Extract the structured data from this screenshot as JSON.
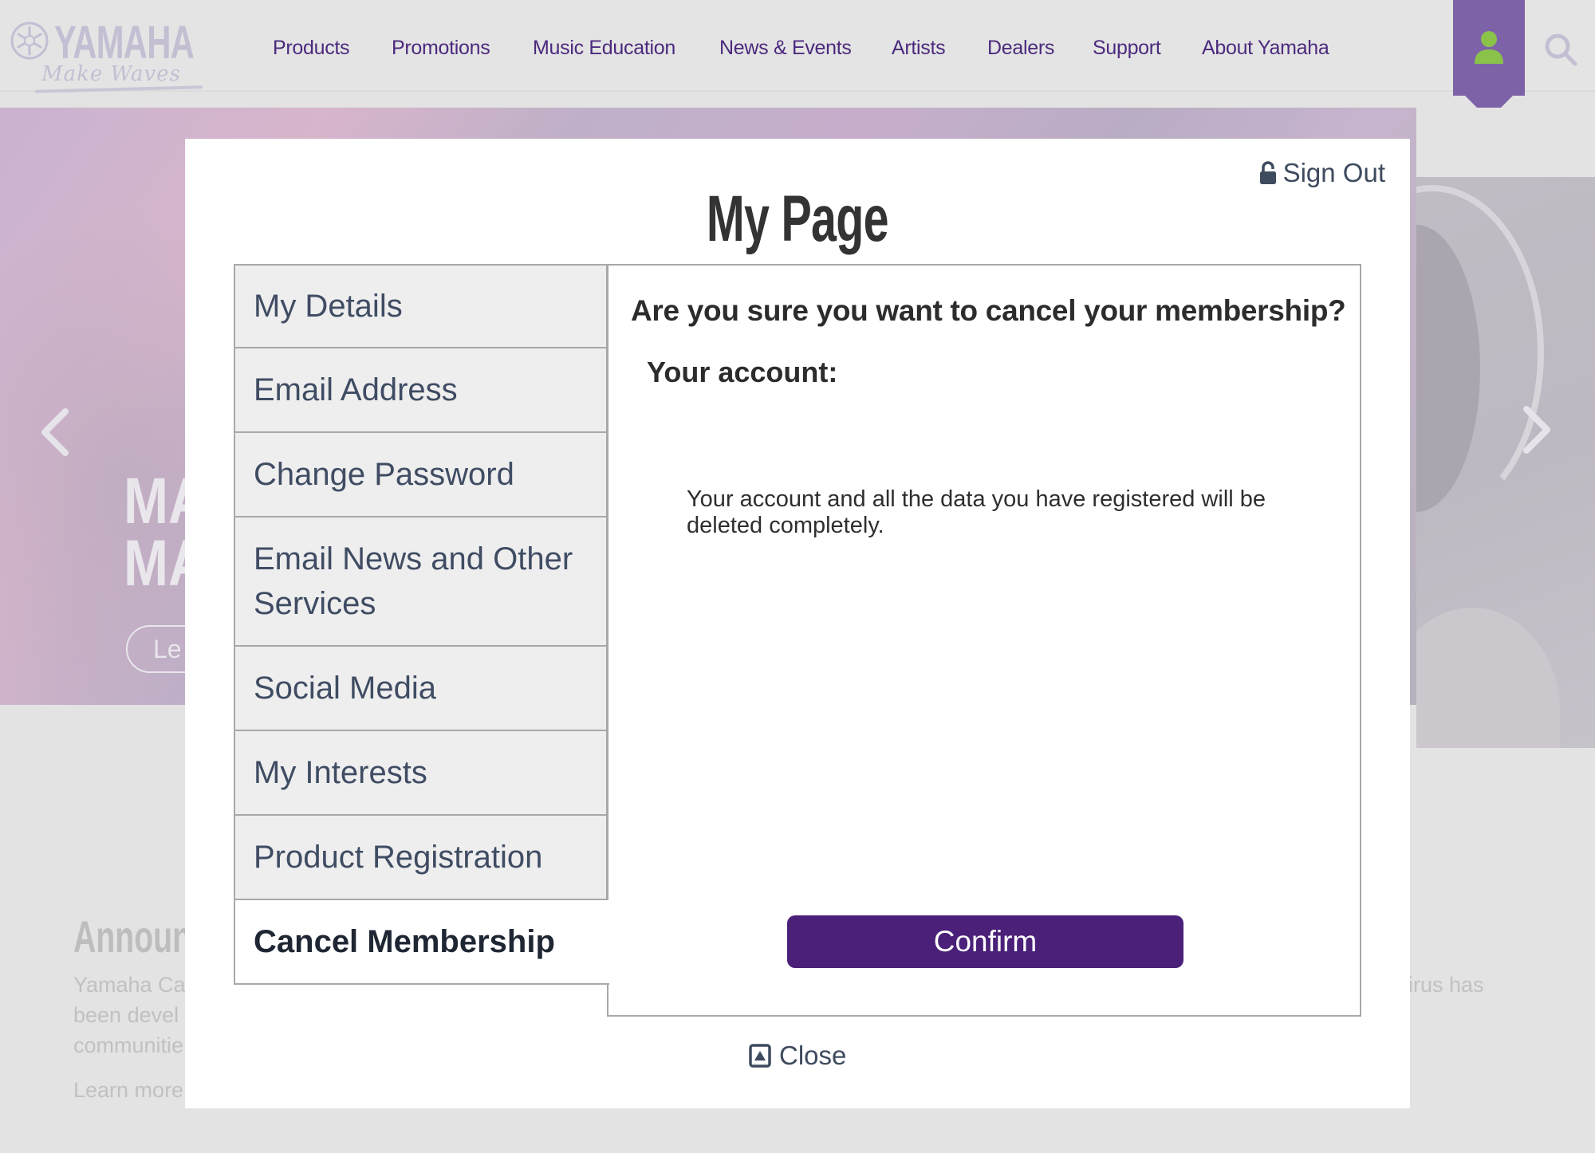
{
  "header": {
    "logo_word": "YAMAHA",
    "logo_tagline": "Make Waves",
    "nav": [
      {
        "label": "Products"
      },
      {
        "label": "Promotions"
      },
      {
        "label": "Music Education"
      },
      {
        "label": "News & Events"
      },
      {
        "label": "Artists"
      },
      {
        "label": "Dealers"
      },
      {
        "label": "Support"
      },
      {
        "label": "About Yamaha"
      }
    ],
    "icons": {
      "user": "user-icon",
      "search": "search-icon"
    },
    "colors": {
      "nav_text": "#4b2a7d",
      "user_tab": "#7e62a8",
      "user_icon": "#8bc34a"
    }
  },
  "hero": {
    "title_lines": [
      "MA",
      "MA"
    ],
    "button_label": "Le"
  },
  "background": {
    "announcement_title": "Announc",
    "announcement_lines": [
      "Yamaha Ca",
      "been devel",
      "communitie"
    ],
    "learn_more": "Learn more",
    "right_fragment": "irus has"
  },
  "modal": {
    "sign_out_label": "Sign Out",
    "title": "My Page",
    "sidebar": [
      {
        "label": "My Details",
        "active": false
      },
      {
        "label": "Email Address",
        "active": false
      },
      {
        "label": "Change Password",
        "active": false
      },
      {
        "label": "Email News and Other Services",
        "active": false
      },
      {
        "label": "Social Media",
        "active": false
      },
      {
        "label": "My Interests",
        "active": false
      },
      {
        "label": "Product Registration",
        "active": false
      },
      {
        "label": "Cancel Membership",
        "active": true
      }
    ],
    "content": {
      "heading": "Are you sure you want to cancel your membership?",
      "account_label": "Your account:",
      "warning": "Your account and all the data you have registered will be deleted completely.",
      "confirm_label": "Confirm"
    },
    "close_label": "Close",
    "colors": {
      "confirm_bg": "#4a2079",
      "text": "#3f4c63"
    }
  }
}
